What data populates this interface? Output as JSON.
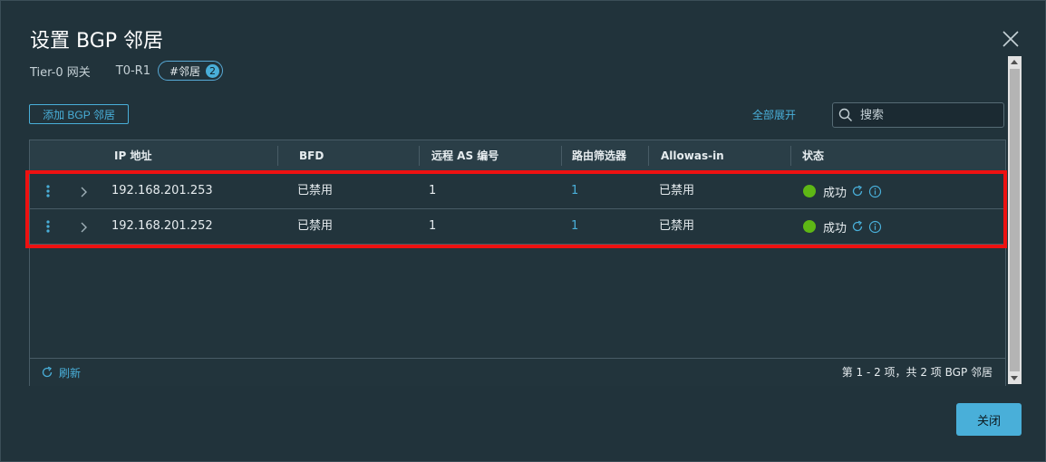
{
  "dialog": {
    "title": "设置 BGP 邻居",
    "breadcrumb": {
      "gateway_type": "Tier-0 网关",
      "gateway_name": "T0-R1",
      "neighbors_tag": "#邻居",
      "neighbors_count": "2"
    },
    "add_button": "添加 BGP 邻居",
    "expand_all": "全部展开",
    "search": {
      "placeholder": "搜索",
      "value": ""
    },
    "close_button": "关闭"
  },
  "grid": {
    "columns": [
      "IP 地址",
      "BFD",
      "远程 AS 编号",
      "路由筛选器",
      "Allowas-in",
      "状态"
    ],
    "rows": [
      {
        "ip": "192.168.201.253",
        "bfd": "已禁用",
        "remote_as": "1",
        "route_filter": "1",
        "allowas_in": "已禁用",
        "status": "成功"
      },
      {
        "ip": "192.168.201.252",
        "bfd": "已禁用",
        "remote_as": "1",
        "route_filter": "1",
        "allowas_in": "已禁用",
        "status": "成功"
      }
    ],
    "footer": {
      "refresh": "刷新",
      "pagination": "第 1 - 2 项，共 2 项 BGP 邻居"
    }
  },
  "colors": {
    "accent": "#49afd9",
    "success": "#5eb715",
    "highlight": "#ee1111",
    "background": "#21333b"
  },
  "icons": [
    "close-icon",
    "search-icon",
    "row-actions-icon",
    "expand-chevron-icon",
    "status-success-icon",
    "refresh-icon",
    "info-icon"
  ]
}
